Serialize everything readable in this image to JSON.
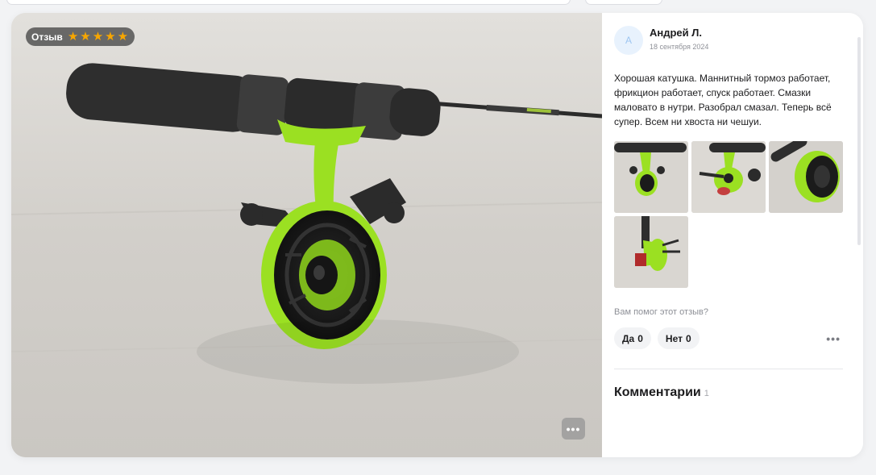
{
  "review": {
    "badge_label": "Отзыв",
    "rating": 5,
    "star_glyph": "★",
    "author_initial": "А",
    "author_name": "Андрей Л.",
    "date": "18 сентября 2024",
    "text": "Хорошая катушка. Маннитный тормоз работает, фрикцион работает, спуск работает. Смазки маловато в нутри. Разобрал смазал. Теперь всё супер. Всем ни хвоста ни чешуи.",
    "thumbnails_count": 4
  },
  "feedback": {
    "question": "Вам помог этот отзыв?",
    "yes_label": "Да",
    "yes_count": "0",
    "no_label": "Нет",
    "no_count": "0",
    "more_glyph": "•••"
  },
  "comments": {
    "title": "Комментарии",
    "count": "1"
  },
  "photo": {
    "more_glyph": "•••",
    "icons": [
      "star-icon",
      "more-icon"
    ]
  },
  "colors": {
    "accent_green": "#9be022",
    "star": "#f7a600",
    "avatar_bg": "#e8f2fd"
  }
}
